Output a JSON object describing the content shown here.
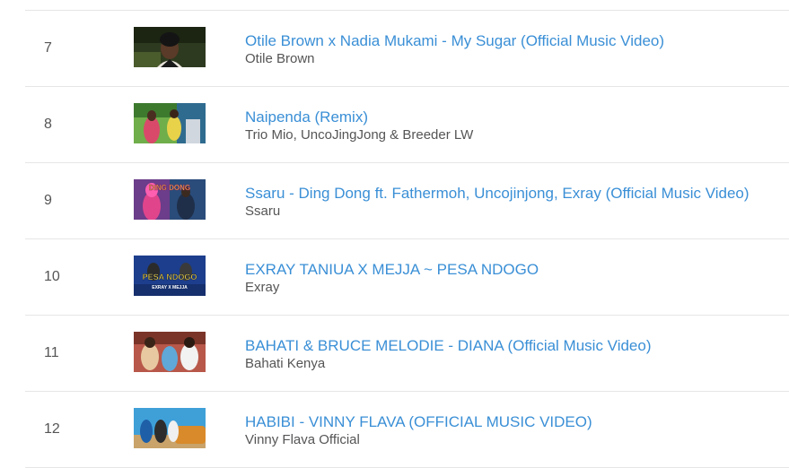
{
  "rows": [
    {
      "rank": "7",
      "title": "Otile Brown x Nadia Mukami - My Sugar (Official Music Video)",
      "artist": "Otile Brown"
    },
    {
      "rank": "8",
      "title": "Naipenda (Remix)",
      "artist": "Trio Mio, UncoJingJong & Breeder LW"
    },
    {
      "rank": "9",
      "title": "Ssaru - Ding Dong ft. Fathermoh, Uncojinjong, Exray (Official Music Video)",
      "artist": "Ssaru",
      "thumb_text": "DING DONG"
    },
    {
      "rank": "10",
      "title": "EXRAY TANIUA X MEJJA ~ PESA NDOGO",
      "artist": "Exray",
      "thumb_text": "PESA NDOGO",
      "thumb_subtext": "EXRAY X MEJJA"
    },
    {
      "rank": "11",
      "title": "BAHATI & BRUCE MELODIE - DIANA (Official Music Video)",
      "artist": "Bahati Kenya"
    },
    {
      "rank": "12",
      "title": "HABIBI - VINNY FLAVA (OFFICIAL MUSIC VIDEO)",
      "artist": "Vinny Flava Official"
    }
  ],
  "colors": {
    "link": "#3a8fd6",
    "text": "#555555",
    "divider": "#e6e6e6"
  }
}
